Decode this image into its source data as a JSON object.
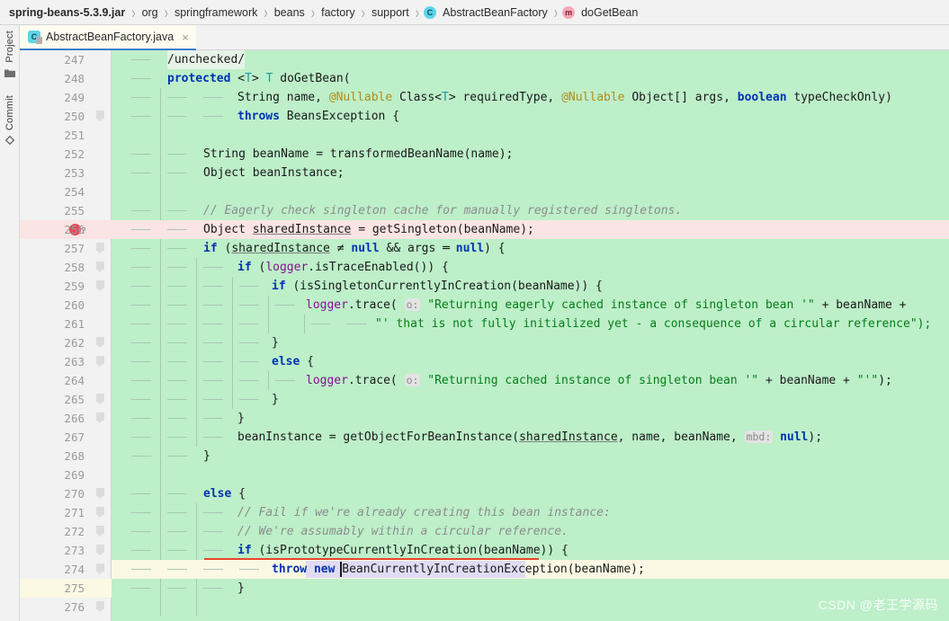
{
  "breadcrumb": {
    "items": [
      {
        "label": "spring-beans-5.3.9.jar",
        "badge": ""
      },
      {
        "label": "org",
        "badge": ""
      },
      {
        "label": "springframework",
        "badge": ""
      },
      {
        "label": "beans",
        "badge": ""
      },
      {
        "label": "factory",
        "badge": ""
      },
      {
        "label": "support",
        "badge": ""
      },
      {
        "label": "AbstractBeanFactory",
        "badge": "C"
      },
      {
        "label": "doGetBean",
        "badge": "m"
      }
    ],
    "separator": "›"
  },
  "tab": {
    "label": "AbstractBeanFactory.java",
    "icon_letter": "C",
    "close_label": "×"
  },
  "sidebar": {
    "items": [
      {
        "label": "Project",
        "icon": "folder-icon"
      },
      {
        "label": "Commit",
        "icon": "commit-diamond-icon"
      }
    ]
  },
  "editor": {
    "first_line": 247,
    "cursor_line": 274,
    "breakpoint_line": 256,
    "breakpoint_marker": "?",
    "error_underline_line": 273,
    "colors": {
      "added_line_bg": "#bdefc9",
      "modified_line_bg": "#fbe4e4",
      "current_line_bg": "#fbf8e3",
      "keyword": "#0033b3",
      "string": "#067d17",
      "comment": "#8c8c8c",
      "annotation": "#b38b16",
      "static_field": "#871094",
      "type_param": "#20999d",
      "breakpoint": "#e8485a",
      "error": "#e8452a",
      "tab_underline": "#3d7fd0"
    },
    "lines": [
      {
        "n": 247,
        "text": "/unchecked/"
      },
      {
        "n": 248,
        "text": "protected <T> T doGetBean("
      },
      {
        "n": 249,
        "text": "        String name, @Nullable Class<T> requiredType, @Nullable Object[] args, boolean typeCheckOnly)"
      },
      {
        "n": 250,
        "text": "        throws BeansException {"
      },
      {
        "n": 251,
        "text": ""
      },
      {
        "n": 252,
        "text": "    String beanName = transformedBeanName(name);"
      },
      {
        "n": 253,
        "text": "    Object beanInstance;"
      },
      {
        "n": 254,
        "text": ""
      },
      {
        "n": 255,
        "text": "    // Eagerly check singleton cache for manually registered singletons."
      },
      {
        "n": 256,
        "text": "    Object sharedInstance = getSingleton(beanName);"
      },
      {
        "n": 257,
        "text": "    if (sharedInstance != null && args == null) {"
      },
      {
        "n": 258,
        "text": "        if (logger.isTraceEnabled()) {"
      },
      {
        "n": 259,
        "text": "            if (isSingletonCurrentlyInCreation(beanName)) {"
      },
      {
        "n": 260,
        "text": "                logger.trace( o: \"Returning eagerly cached instance of singleton bean '\" + beanName +"
      },
      {
        "n": 261,
        "text": "                        \"' that is not fully initialized yet - a consequence of a circular reference\");"
      },
      {
        "n": 262,
        "text": "            }"
      },
      {
        "n": 263,
        "text": "            else {"
      },
      {
        "n": 264,
        "text": "                logger.trace( o: \"Returning cached instance of singleton bean '\" + beanName + \"'\");"
      },
      {
        "n": 265,
        "text": "            }"
      },
      {
        "n": 266,
        "text": "        }"
      },
      {
        "n": 267,
        "text": "        beanInstance = getObjectForBeanInstance(sharedInstance, name, beanName,  mbd: null);"
      },
      {
        "n": 268,
        "text": "    }"
      },
      {
        "n": 269,
        "text": ""
      },
      {
        "n": 270,
        "text": "    else {"
      },
      {
        "n": 271,
        "text": "        // Fail if we're already creating this bean instance:"
      },
      {
        "n": 272,
        "text": "        // We're assumably within a circular reference."
      },
      {
        "n": 273,
        "text": "        if (isPrototypeCurrentlyInCreation(beanName)) {"
      },
      {
        "n": 274,
        "text": "            throw new BeanCurrentlyInCreationException(beanName);"
      },
      {
        "n": 275,
        "text": "        }"
      },
      {
        "n": 276,
        "text": ""
      }
    ],
    "parameter_hints": [
      "o:",
      "mbd:"
    ],
    "highlighted_identifier": "BeanCurrentlyInCreationException"
  },
  "watermark": {
    "text": "CSDN @老王学源码"
  }
}
